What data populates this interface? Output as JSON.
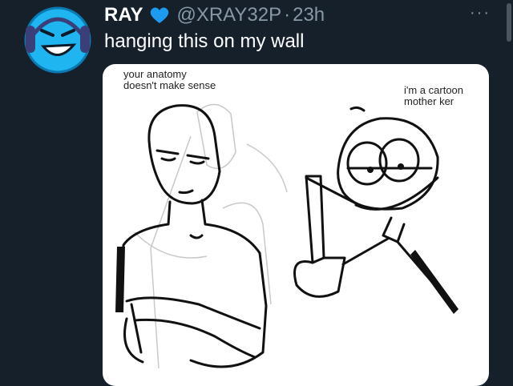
{
  "tweet": {
    "author_name": "RAY",
    "handle": "@XRAY32P",
    "separator": "·",
    "timestamp": "23h",
    "text": "hanging this on my wall",
    "more_icon": "···",
    "verified_badge_color": "#1d9bf0"
  },
  "media": {
    "caption_left": "your anatomy\ndoesn't make sense",
    "caption_right": "i'm a cartoon\nmother     ker"
  },
  "colors": {
    "background": "#15202b",
    "text_primary": "#ffffff",
    "text_secondary": "#8899a6",
    "avatar_blue": "#1fb5f0"
  }
}
